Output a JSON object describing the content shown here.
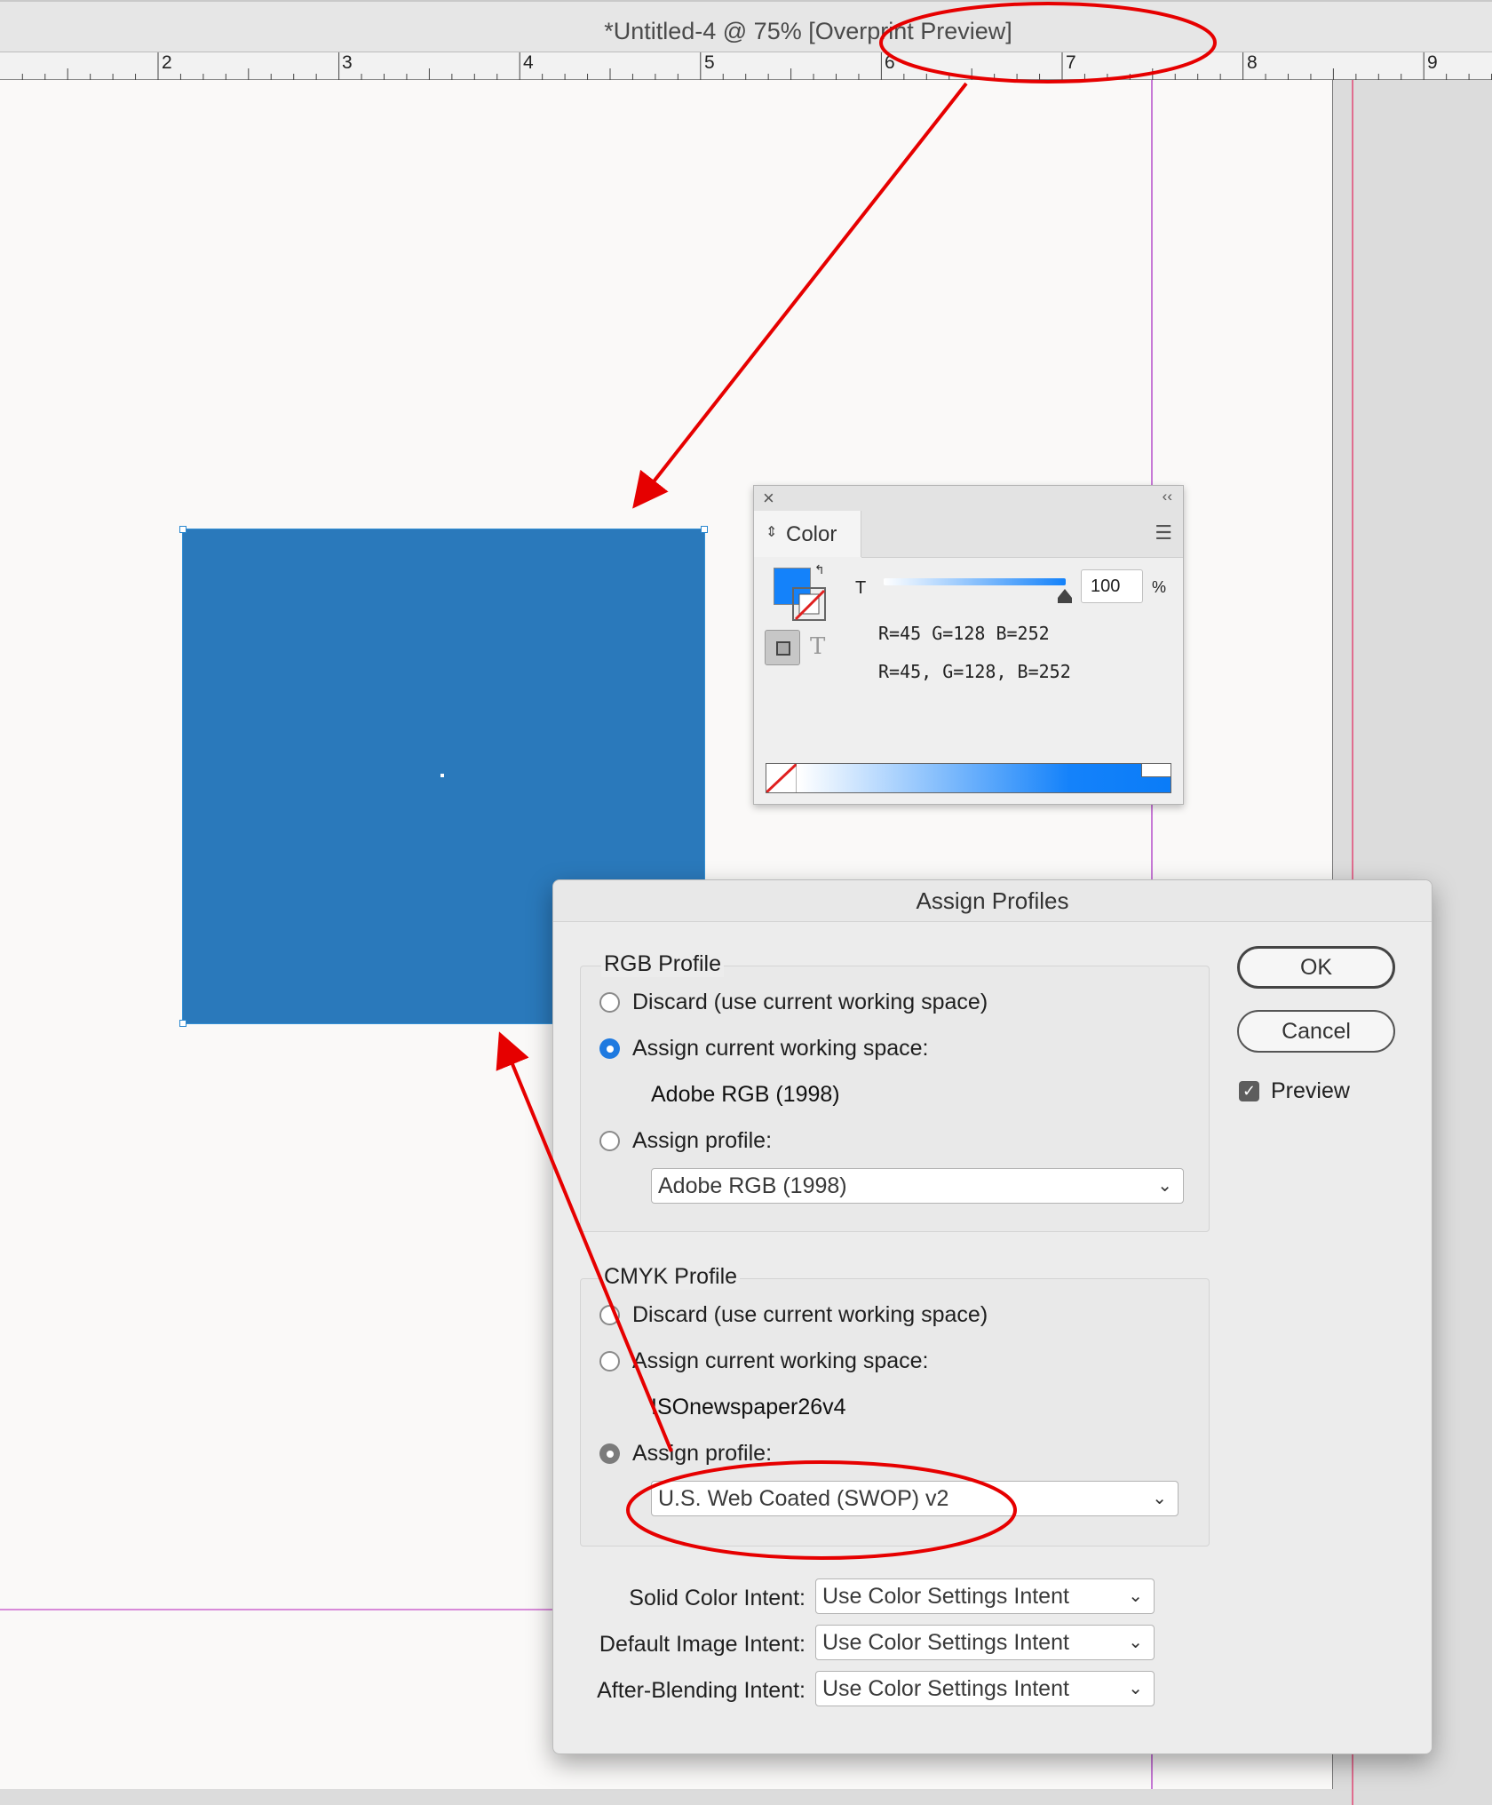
{
  "window": {
    "title": "*Untitled-4 @ 75% [Overprint Preview]"
  },
  "ruler": {
    "ticks": [
      "2",
      "3",
      "4",
      "5",
      "6",
      "7",
      "8",
      "9"
    ]
  },
  "color_panel": {
    "tab_label": "Color",
    "close_glyph": "×",
    "collapse_glyph": "‹‹",
    "tint_label": "T",
    "tint_value": "100",
    "percent": "%",
    "fill_color": "#1482fa",
    "rgb_line1": "R=45 G=128 B=252",
    "rgb_line2": "R=45, G=128, B=252",
    "text_glyph": "T"
  },
  "dialog": {
    "title": "Assign Profiles",
    "rgb": {
      "label": "RGB Profile",
      "discard": "Discard (use current working space)",
      "assign_current": "Assign current working space:",
      "current_space": "Adobe RGB (1998)",
      "assign_profile": "Assign profile:",
      "profile_value": "Adobe RGB (1998)",
      "selected": "assign_current"
    },
    "cmyk": {
      "label": "CMYK Profile",
      "discard": "Discard (use current working space)",
      "assign_current": "Assign current working space:",
      "current_space": "ISOnewspaper26v4",
      "assign_profile": "Assign profile:",
      "profile_value": "U.S. Web Coated (SWOP) v2",
      "selected": "assign_profile"
    },
    "intents": [
      {
        "label": "Solid Color Intent:",
        "value": "Use Color Settings Intent"
      },
      {
        "label": "Default Image Intent:",
        "value": "Use Color Settings Intent"
      },
      {
        "label": "After-Blending Intent:",
        "value": "Use Color Settings Intent"
      }
    ],
    "ok": "OK",
    "cancel": "Cancel",
    "preview": "Preview",
    "preview_checked": true
  },
  "colors": {
    "object_fill": "#2a79bb",
    "annotation": "#e60000",
    "accent": "#1f7ae0"
  }
}
